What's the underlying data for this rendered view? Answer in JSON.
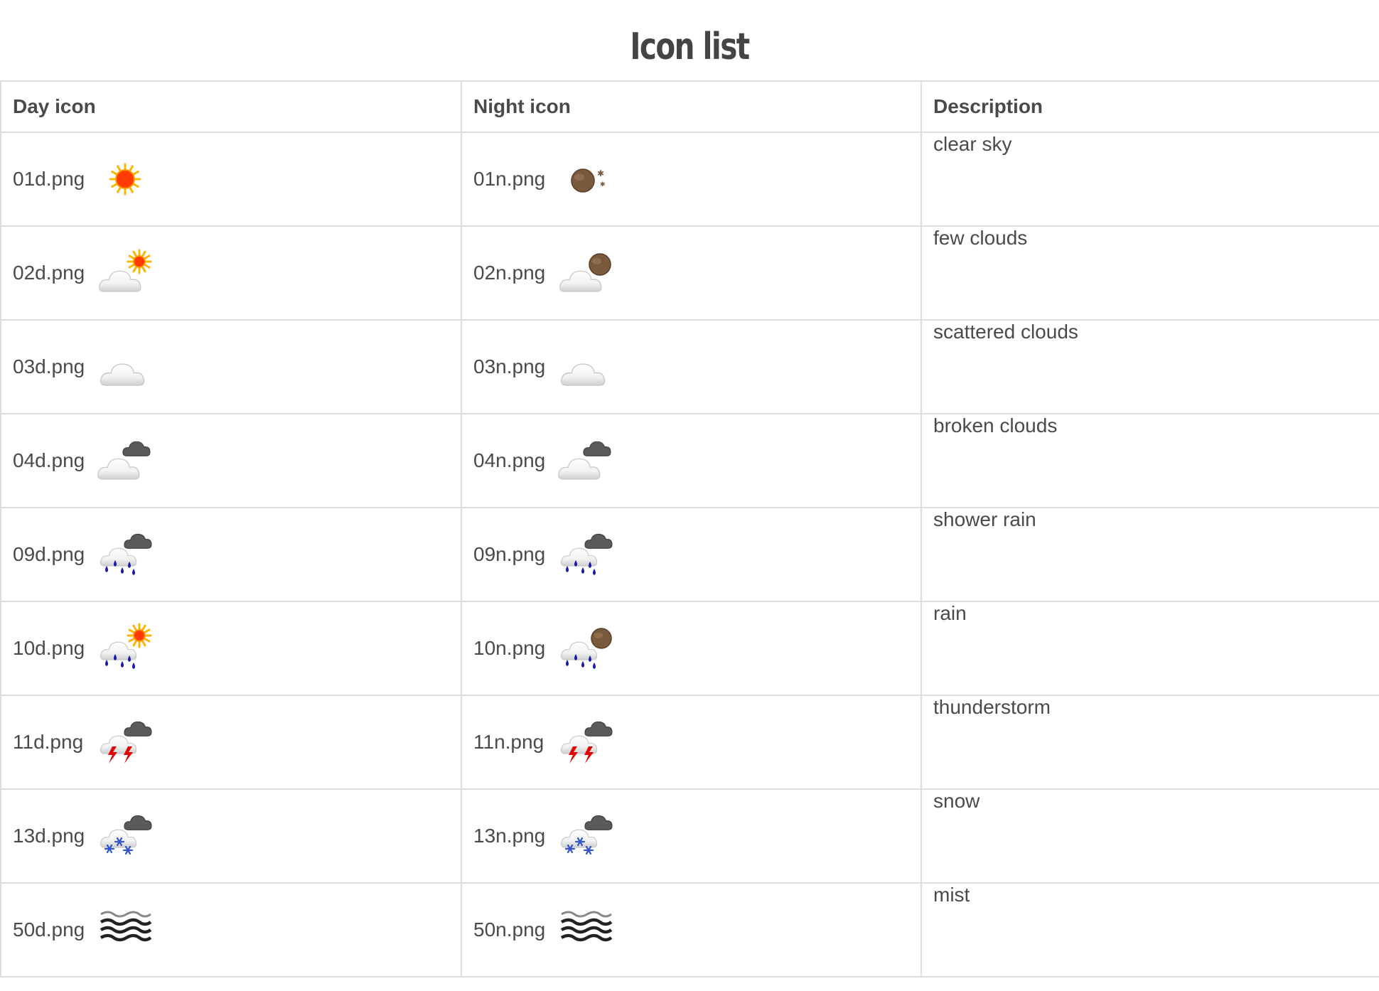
{
  "title": "Icon list",
  "columns": [
    "Day icon",
    "Night icon",
    "Description"
  ],
  "rows": [
    {
      "day": "01d.png",
      "day_icon": "clear-sky-day-icon",
      "night": "01n.png",
      "night_icon": "clear-sky-night-icon",
      "description": "clear sky"
    },
    {
      "day": "02d.png",
      "day_icon": "few-clouds-day-icon",
      "night": "02n.png",
      "night_icon": "few-clouds-night-icon",
      "description": "few clouds"
    },
    {
      "day": "03d.png",
      "day_icon": "scattered-clouds-icon",
      "night": "03n.png",
      "night_icon": "scattered-clouds-icon",
      "description": "scattered clouds"
    },
    {
      "day": "04d.png",
      "day_icon": "broken-clouds-icon",
      "night": "04n.png",
      "night_icon": "broken-clouds-icon",
      "description": "broken clouds"
    },
    {
      "day": "09d.png",
      "day_icon": "shower-rain-icon",
      "night": "09n.png",
      "night_icon": "shower-rain-icon",
      "description": "shower rain"
    },
    {
      "day": "10d.png",
      "day_icon": "rain-day-icon",
      "night": "10n.png",
      "night_icon": "rain-night-icon",
      "description": "rain"
    },
    {
      "day": "11d.png",
      "day_icon": "thunderstorm-icon",
      "night": "11n.png",
      "night_icon": "thunderstorm-icon",
      "description": "thunderstorm"
    },
    {
      "day": "13d.png",
      "day_icon": "snow-icon",
      "night": "13n.png",
      "night_icon": "snow-icon",
      "description": "snow"
    },
    {
      "day": "50d.png",
      "day_icon": "mist-icon",
      "night": "50n.png",
      "night_icon": "mist-icon",
      "description": "mist"
    }
  ],
  "colors": {
    "text": "#4a4a4a",
    "border": "#dcdcdc",
    "sun": "#ff3b00",
    "moon": "#7a5a3c",
    "rain": "#1a1aa8",
    "lightning": "#e00000",
    "snow": "#3355cc"
  }
}
